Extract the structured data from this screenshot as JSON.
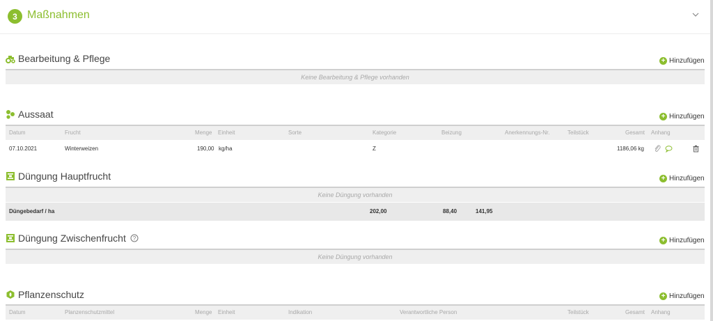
{
  "header": {
    "step": "3",
    "title": "Maßnahmen"
  },
  "add_label": "Hinzufügen",
  "bearbeitung": {
    "title": "Bearbeitung & Pflege",
    "empty": "Keine Bearbeitung & Pflege vorhanden"
  },
  "aussaat": {
    "title": "Aussaat",
    "columns": {
      "datum": "Datum",
      "frucht": "Frucht",
      "menge": "Menge",
      "einheit": "Einheit",
      "sorte": "Sorte",
      "kategorie": "Kategorie",
      "beizung": "Beizung",
      "anerkennung": "Anerkennungs-Nr.",
      "teilstueck": "Teilstück",
      "gesamt": "Gesamt",
      "anhang": "Anhang"
    },
    "rows": [
      {
        "datum": "07.10.2021",
        "frucht": "Winterweizen",
        "menge": "190,00",
        "einheit": "kg/ha",
        "kategorie": "Z",
        "gesamt": "1186,06 kg"
      }
    ]
  },
  "duengung_haupt": {
    "title": "Düngung Hauptfrucht",
    "empty": "Keine Düngung vorhanden",
    "summary": {
      "label": "Düngebedarf / ha",
      "v1": "202,00",
      "v2": "88,40",
      "v3": "141,95"
    }
  },
  "duengung_zwischen": {
    "title": "Düngung Zwischenfrucht",
    "empty": "Keine Düngung vorhanden"
  },
  "pflanzenschutz": {
    "title": "Pflanzenschutz",
    "columns": {
      "datum": "Datum",
      "mittel": "Planzenschutzmittel",
      "menge": "Menge",
      "einheit": "Einheit",
      "indikation": "Indikation",
      "person": "Verantwortliche Person",
      "teilstueck": "Teilstück",
      "gesamt": "Gesamt",
      "anhang": "Anhang"
    }
  },
  "icons": {
    "tractor": "tractor-icon",
    "seed": "seed-icon",
    "fertilizer": "fertilizer-icon",
    "shield": "crop-protection-icon",
    "help": "help-icon",
    "attachment": "paperclip-icon",
    "comment": "comment-icon",
    "delete": "trash-icon",
    "add": "plus-circle-icon",
    "collapse": "chevron-down-icon"
  },
  "colors": {
    "accent": "#8cbe2f",
    "rule": "#cfcfcf",
    "row_bg": "#efefef",
    "summary_bg": "#e8e8e8"
  }
}
